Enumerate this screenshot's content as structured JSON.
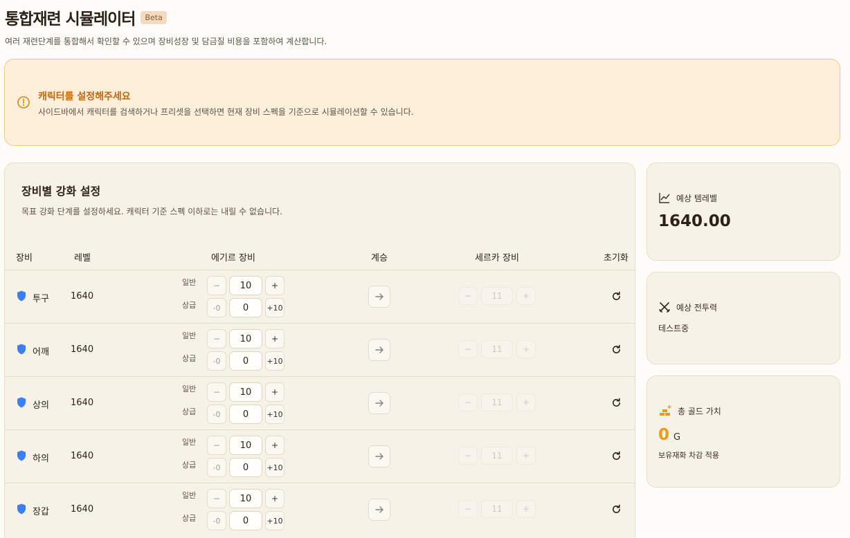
{
  "header": {
    "title": "통합재련 시뮬레이터",
    "badge": "Beta",
    "subtitle": "여러 재련단계를 통합해서 확인할 수 있으며 장비성장 및 담금질 비용을 포함하여 계산합니다."
  },
  "alert": {
    "icon": "alert-circle-icon",
    "title": "캐릭터를 설정해주세요",
    "text": "사이드바에서 캐릭터를 검색하거나 프리셋을 선택하면 현재 장비 스펙을 기준으로 시뮬레이션할 수 있습니다."
  },
  "panel": {
    "title": "장비별 강화 설정",
    "description": "목표 강화 단계를 설정하세요. 캐릭터 기준 스펙 이하로는 내릴 수 없습니다.",
    "columns": [
      "장비",
      "레벨",
      "에기르 장비",
      "계승",
      "세르카 장비",
      "초기화"
    ],
    "tier_labels": {
      "normal": "일반",
      "advanced": "상급"
    },
    "buttons": {
      "minus": "−",
      "plus": "+",
      "adv_minus": "-0",
      "adv_plus": "+10"
    },
    "rows": [
      {
        "name": "투구",
        "level": "1640",
        "normal": "10",
        "advanced": "0",
        "serka": "11"
      },
      {
        "name": "어깨",
        "level": "1640",
        "normal": "10",
        "advanced": "0",
        "serka": "11"
      },
      {
        "name": "상의",
        "level": "1640",
        "normal": "10",
        "advanced": "0",
        "serka": "11"
      },
      {
        "name": "하의",
        "level": "1640",
        "normal": "10",
        "advanced": "0",
        "serka": "11"
      },
      {
        "name": "장갑",
        "level": "1640",
        "normal": "10",
        "advanced": "0",
        "serka": "11"
      }
    ]
  },
  "cards": {
    "item_level": {
      "icon": "chart-line-icon",
      "label": "예상 템레벨",
      "value": "1640.00"
    },
    "combat_power": {
      "icon": "crossed-swords-icon",
      "label": "예상 전투력",
      "value": "테스트중"
    },
    "gold": {
      "icon": "gold-bars-icon",
      "label": "총 골드 가치",
      "value": "0",
      "unit": "G",
      "note": "보유재화 차감 적용"
    }
  },
  "colors": {
    "accent": "#ef9b12",
    "alert_title": "#c2680f",
    "shield": "#3b7ff2"
  }
}
